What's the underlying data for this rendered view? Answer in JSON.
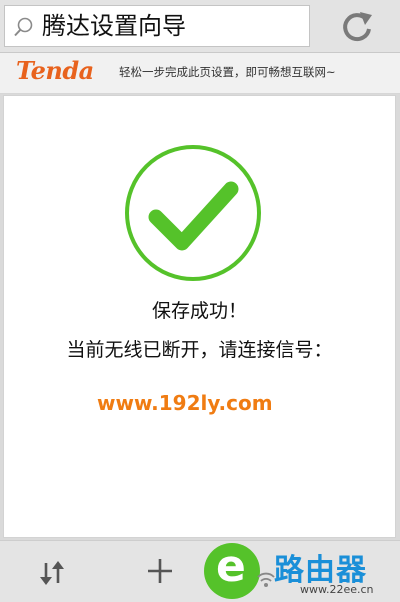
{
  "address_bar": {
    "title": "腾达设置向导"
  },
  "brand": {
    "logo": "Tenda",
    "slogan": "轻松一步完成此页设置，即可畅想互联网~",
    "accent": "#e8621d"
  },
  "main": {
    "status_line_1": "保存成功！",
    "status_line_2": "当前无线已断开，请连接信号：",
    "url": "www.192ly.com",
    "success_color": "#55c22a",
    "url_color": "#f07c12"
  },
  "watermark": {
    "mark": "e",
    "text": "路由器",
    "url": "www.22ee.cn"
  },
  "icons": {
    "search": "magnifier-icon",
    "refresh": "refresh-icon",
    "success": "checkmark-icon",
    "sync": "sync-icon",
    "add": "plus-icon"
  }
}
